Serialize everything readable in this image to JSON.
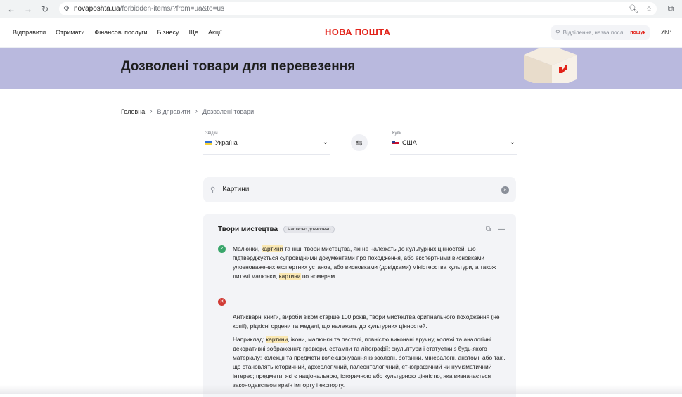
{
  "browser": {
    "url_host": "novaposhta.ua",
    "url_path": "/forbidden-items/?from=ua&to=us"
  },
  "header": {
    "menu": [
      "Відправити",
      "Отримати",
      "Фінансові послуги",
      "Бізнесу",
      "Ще",
      "Акції"
    ],
    "logo": "НОВА ПОШТА",
    "search_placeholder": "Відділення, назва посл",
    "search_button": "пошук",
    "language": "УКР"
  },
  "banner": {
    "title": "Дозволені товари для перевезення"
  },
  "breadcrumb": [
    "Головна",
    "Відправити",
    "Дозволені товари"
  ],
  "route": {
    "from_label": "Звідки",
    "from_value": "Україна",
    "to_label": "Куди",
    "to_value": "США"
  },
  "item_search": {
    "value": "Картини"
  },
  "result": {
    "title": "Твори мистецтва",
    "badge": "Частково дозволено",
    "allowed": {
      "p1": "Малюнки, ",
      "h1": "картини",
      "p2": " та інші твори мистецтва, які не належать до культурних цінностей, що підтверджується супровідними документами про походження, або експертними висновками уловноважених експертних установ, або висновками (довідками) міністерства культури, а також дитячі малюнки, ",
      "h2": "картини",
      "p3": " по номерам"
    },
    "forbidden": {
      "text": "Антикварні книги, вироби віком старше 100 років, твори мистецтва оригінального походження (не копії), рідкісні ордени та медалі, що належать до культурних цінностей.",
      "ex_prefix": "Наприклад: ",
      "ex_hl": "картини",
      "ex_rest": ", ікони, малюнки та пастелі, повністю виконані вручну, колажі та аналогічні декоративні зображення; гравюри, естампи та літографії; скульптури і статуетки з будь-якого матеріалу; колекції та предмети колекціонування із зоології, ботаніки, мінералогії, анатомії або такі, що становлять історичний, археологічний, палеонтологічний, етнографічний чи нумізматичний інтерес; предмети, які є національною, історичною або культурною цінністю, яка визначається законодавством країн імпорту і експорту."
    }
  },
  "colors": {
    "brand": "#e2231a",
    "banner": "#b9b9de",
    "allowed": "#3aa66b",
    "forbidden": "#d03a34",
    "highlight": "#fbe9b4"
  }
}
